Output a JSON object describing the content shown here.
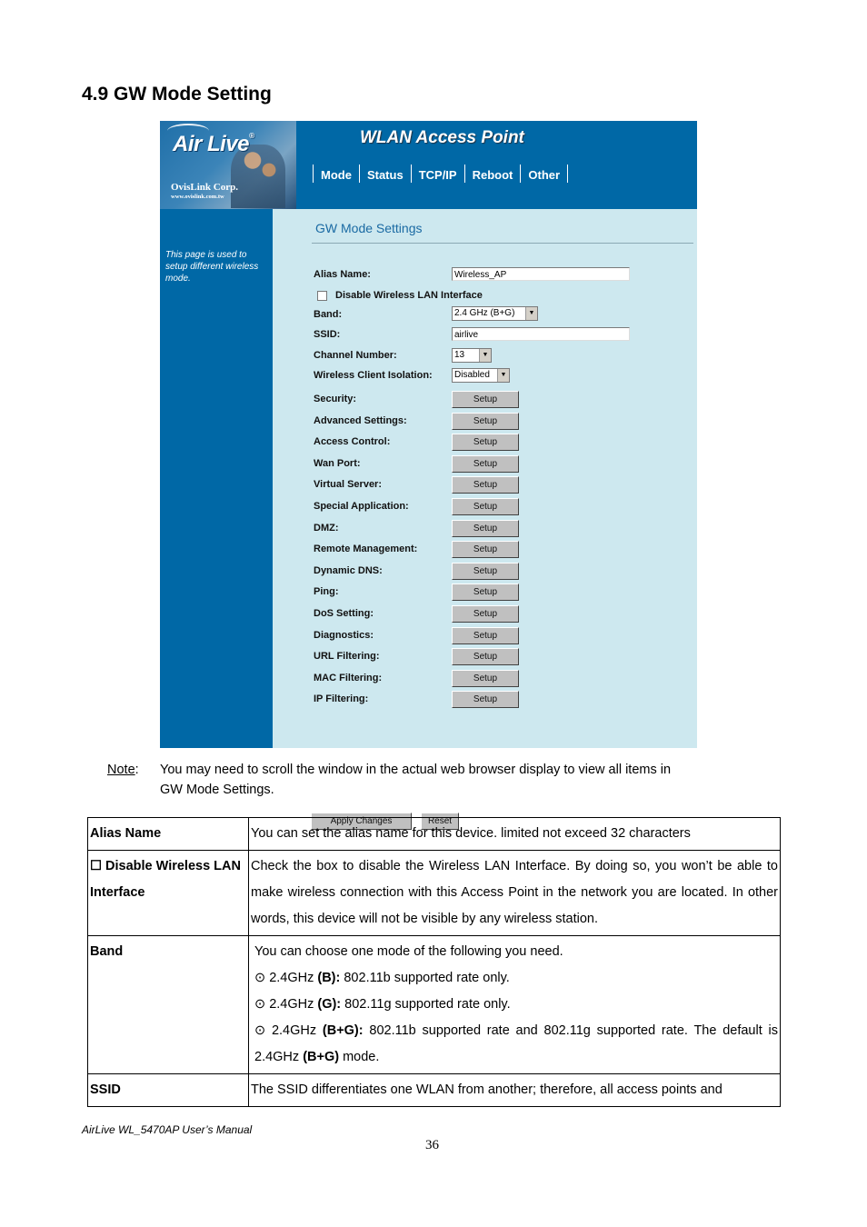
{
  "heading": "4.9 GW Mode Setting",
  "screenshot": {
    "logo": {
      "brand": "Air Live",
      "registered": "®",
      "corp": "OvisLink Corp.",
      "url": "www.ovislink.com.tw"
    },
    "app_title": "WLAN Access Point",
    "nav_tabs": [
      "Mode",
      "Status",
      "TCP/IP",
      "Reboot",
      "Other"
    ],
    "sidebar_help": "This page is used to setup different wireless mode.",
    "page_title": "GW Mode Settings",
    "alias_label": "Alias Name:",
    "alias_value": "Wireless_AP",
    "disable_wlan_label": "Disable Wireless LAN Interface",
    "disable_wlan_checked": false,
    "band_label": "Band:",
    "band_value": "2.4 GHz (B+G)",
    "ssid_label": "SSID:",
    "ssid_value": "airlive",
    "channel_label": "Channel Number:",
    "channel_value": "13",
    "isolation_label": "Wireless Client Isolation:",
    "isolation_value": "Disabled",
    "setup_label": "Setup",
    "setup_items": [
      "Security:",
      "Advanced Settings:",
      "Access Control:",
      "Wan Port:",
      "Virtual Server:",
      "Special Application:",
      "DMZ:",
      "Remote Management:",
      "Dynamic DNS:",
      "Ping:",
      "DoS Setting:",
      "Diagnostics:",
      "URL Filtering:",
      "MAC Filtering:",
      "IP Filtering:"
    ],
    "apply_label": "Apply Changes",
    "reset_label": "Reset"
  },
  "note": {
    "label": "Note",
    "line1": "You may need to scroll the window in the actual web browser display to view all items in",
    "line2": "GW Mode Settings."
  },
  "table": {
    "rows": [
      {
        "key": "Alias Name",
        "value": "You can set the alias name for this device. limited not exceed 32 characters"
      },
      {
        "key": "☐  Disable  Wireless LAN Interface",
        "value": "Check the box to disable the Wireless LAN Interface.   By doing so, you won’t be able to make wireless connection with this Access Point in the network you are located. In other words, this device will not be visible by any wireless station."
      },
      {
        "key": "Band",
        "intro": "You can choose one mode of the following you need.",
        "options": [
          {
            "bullet": "⊙",
            "pre": "2.4GHz ",
            "bold": "(B):",
            "post": " 802.11b supported rate only."
          },
          {
            "bullet": "⊙",
            "pre": "2.4GHz ",
            "bold": "(G):",
            "post": " 802.11g supported rate only."
          },
          {
            "bullet": "⊙",
            "pre": "2.4GHz ",
            "bold": "(B+G):",
            "post": " 802.11b supported rate and 802.11g supported rate. The default is 2.4GHz "
          }
        ],
        "default_bold": "(B+G)",
        "default_tail": " mode."
      },
      {
        "key": "SSID",
        "value": "The SSID differentiates one WLAN from another; therefore, all access points and"
      }
    ]
  },
  "footer": "AirLive WL_5470AP User’s Manual",
  "page_number": "36"
}
